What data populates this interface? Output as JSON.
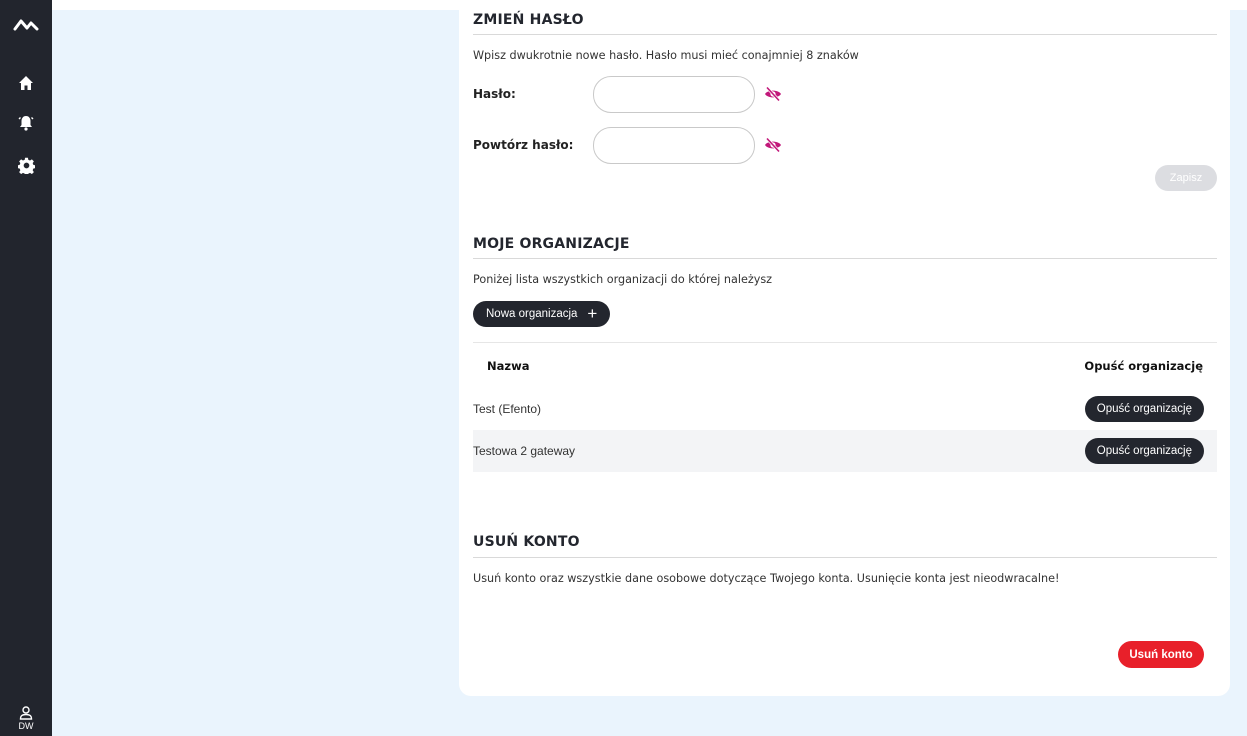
{
  "sidebar": {
    "items": [
      {
        "name": "logo",
        "icon": "trend-logo-icon"
      },
      {
        "name": "home",
        "icon": "home-icon"
      },
      {
        "name": "alerts",
        "icon": "bell-icon"
      },
      {
        "name": "settings",
        "icon": "gear-icon"
      }
    ],
    "user": {
      "icon": "user-icon",
      "initials": "DW"
    }
  },
  "change_password": {
    "title": "ZMIEŃ HASŁO",
    "description": "Wpisz dwukrotnie nowe hasło. Hasło musi mieć conajmniej 8 znaków",
    "password_label": "Hasło:",
    "password_value": "",
    "repeat_label": "Powtórz hasło:",
    "repeat_value": "",
    "toggle_icon": "eye-slash-icon",
    "save_label": "Zapisz"
  },
  "organizations": {
    "title": "MOJE ORGANIZACJE",
    "description": "Poniżej lista wszystkich organizacji do której należysz",
    "new_button_label": "Nowa organizacja",
    "new_button_icon": "plus-icon",
    "columns": [
      "Nazwa",
      "Opuść organizację"
    ],
    "rows": [
      {
        "name": "Test (Efento)",
        "action_label": "Opuść organizację"
      },
      {
        "name": "Testowa 2 gateway",
        "action_label": "Opuść organizację"
      }
    ]
  },
  "delete_account": {
    "title": "USUŃ KONTO",
    "description": "Usuń konto oraz wszystkie dane osobowe dotyczące Twojego konta. Usunięcie konta jest nieodwracalne!",
    "button_label": "Usuń konto"
  },
  "colors": {
    "sidebar_bg": "#22252d",
    "page_bg": "#eaf4fd",
    "accent_magenta": "#c2187a",
    "danger": "#e8202a",
    "dark_button": "#23262e",
    "disabled_button": "#dcdde1"
  }
}
